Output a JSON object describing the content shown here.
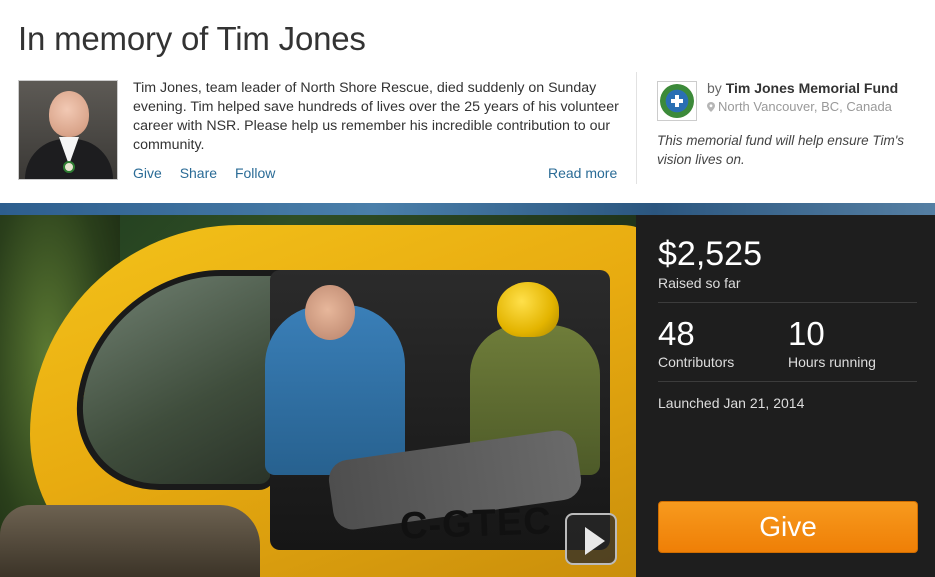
{
  "page": {
    "title": "In memory of Tim Jones"
  },
  "story": {
    "description": "Tim Jones, team leader of North Shore Rescue, died suddenly on Sunday evening. Tim helped save hundreds of lives over the 25 years of his volunteer career with NSR. Please help us remember his incredible contribution to our community.",
    "actions": [
      "Give",
      "Share",
      "Follow"
    ],
    "read_more": "Read more"
  },
  "organizer": {
    "by": "by",
    "name": "Tim Jones Memorial Fund",
    "location": "North Vancouver, BC, Canada",
    "note": "This memorial fund will help ensure Tim's vision lives on."
  },
  "hero": {
    "registration": "C-GTEC"
  },
  "stats": {
    "raised_amount": "$2,525",
    "raised_label": "Raised so far",
    "contributors_count": "48",
    "contributors_label": "Contributors",
    "hours_count": "10",
    "hours_label": "Hours running",
    "launched": "Launched Jan 21, 2014",
    "give_label": "Give"
  },
  "colors": {
    "link": "#2a6b96",
    "give_button": "#f28a10",
    "stats_panel": "#1e1e1e"
  },
  "icons": {
    "location": "map-pin-icon",
    "play": "play-icon"
  }
}
